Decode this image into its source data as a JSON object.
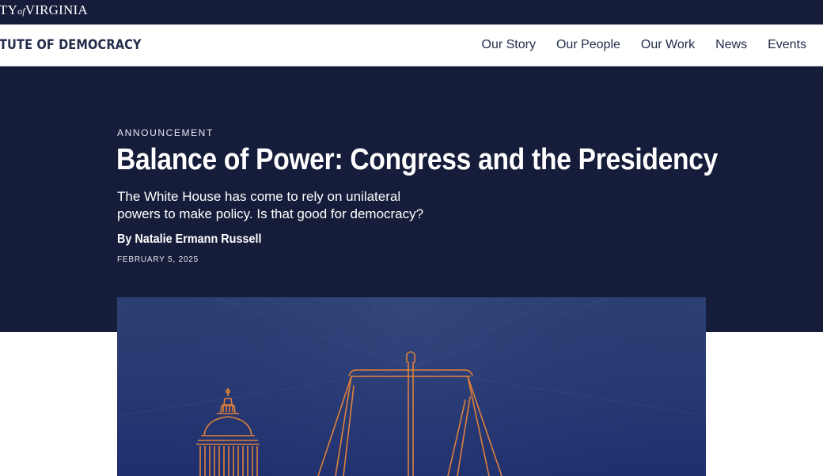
{
  "topbar": {
    "wordmark_prefix": "TY",
    "wordmark_of": "of",
    "wordmark_suffix": "VIRGINIA"
  },
  "navbar": {
    "site_title": "TUTE OF DEMOCRACY",
    "links": [
      "Our Story",
      "Our People",
      "Our Work",
      "News",
      "Events"
    ]
  },
  "article": {
    "eyebrow": "ANNOUNCEMENT",
    "headline": "Balance of Power: Congress and the Presidency",
    "dek": "The White House has come to rely on unilateral powers to make policy. Is that good for democracy?",
    "byline": "By Natalie Ermann Russell",
    "date": "FEBRUARY 5, 2025"
  },
  "colors": {
    "navy": "#161d3a",
    "text_navy": "#232d4b",
    "illustration_bg": "#283a72",
    "illustration_line": "#e0803a"
  },
  "icons": {
    "capitol": "capitol-dome-illustration",
    "scales": "scales-of-justice-illustration"
  }
}
